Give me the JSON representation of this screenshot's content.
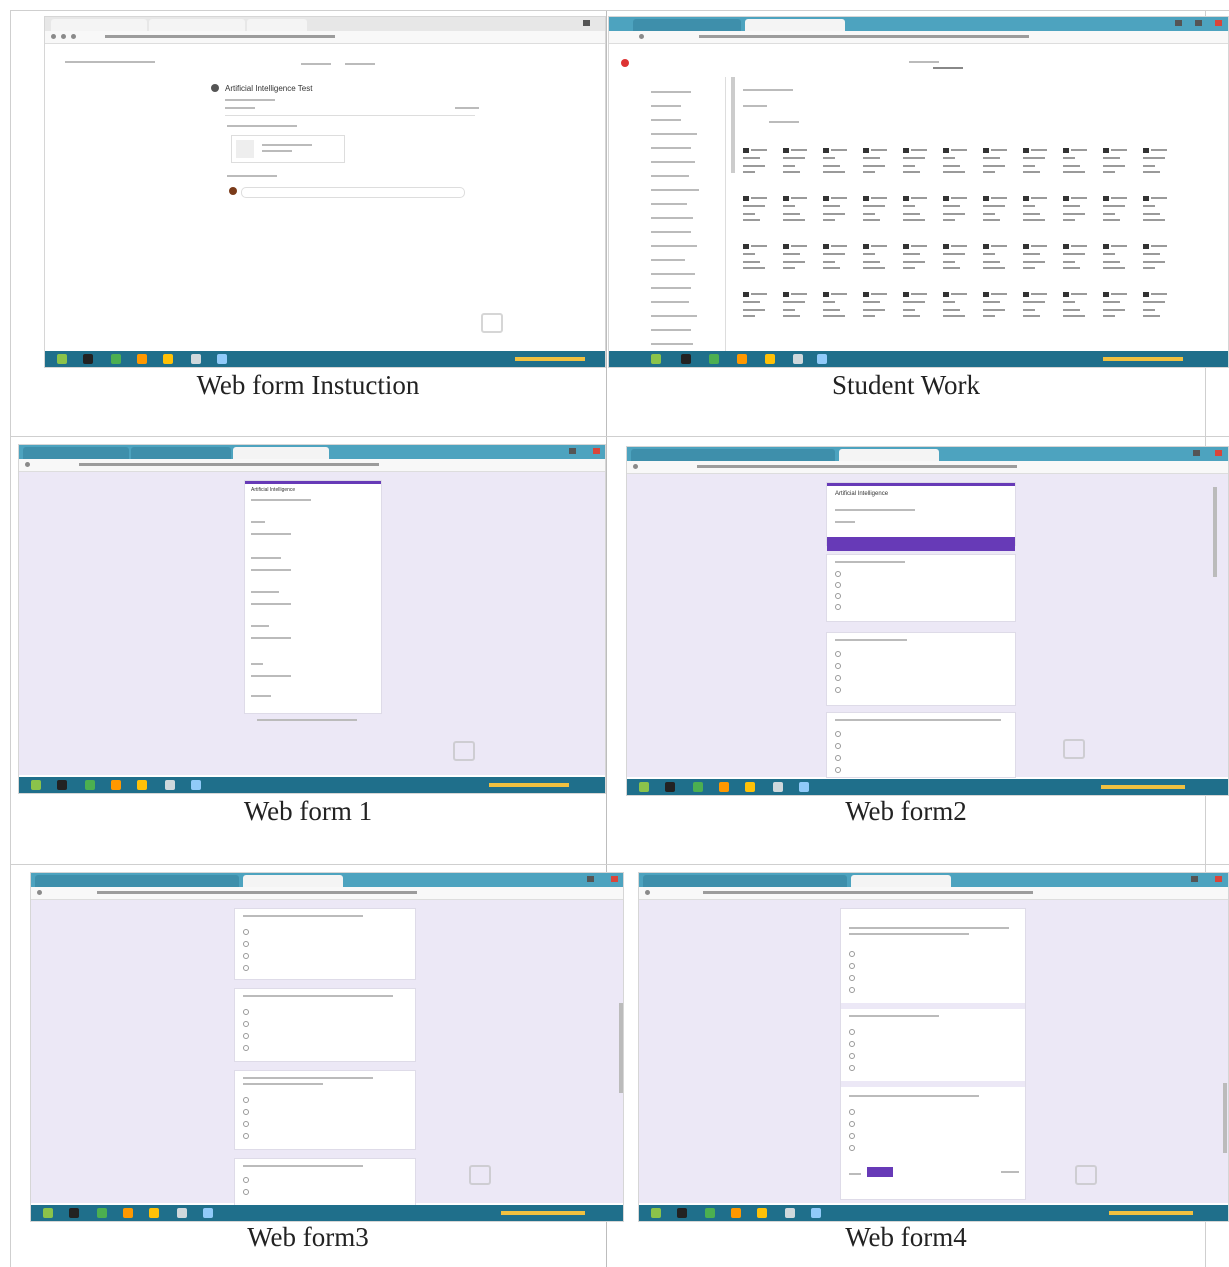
{
  "panels": [
    {
      "id": "instruction",
      "caption": "Web form Instuction",
      "heading": "Artificial Intelligence Test"
    },
    {
      "id": "student-work",
      "caption": "Student Work"
    },
    {
      "id": "form1",
      "caption": "Web form 1",
      "heading": "Artificial Intelligence"
    },
    {
      "id": "form2",
      "caption": "Web form2",
      "heading": "Artificial Intelligence"
    },
    {
      "id": "form3",
      "caption": "Web form3"
    },
    {
      "id": "form4",
      "caption": "Web form4"
    }
  ],
  "colors": {
    "taskbar": "#1f6f8b",
    "tab_teal": "#4da3bf",
    "form_background": "#ece8f6",
    "form_accent": "#673ab7"
  },
  "icons": [
    "start-icon",
    "browser-icon",
    "folder-icon",
    "tray-icon",
    "avatar-icon"
  ]
}
